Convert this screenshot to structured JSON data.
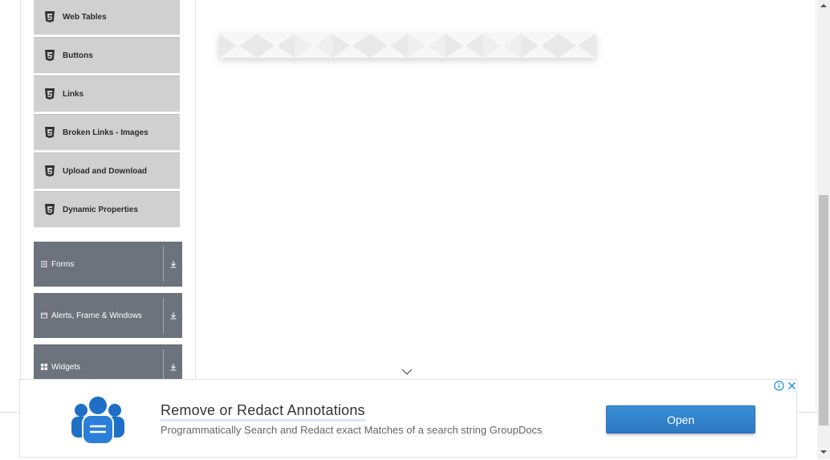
{
  "sidebar": {
    "elements_items": [
      {
        "label": "Web Tables"
      },
      {
        "label": "Buttons"
      },
      {
        "label": "Links"
      },
      {
        "label": "Broken Links - Images"
      },
      {
        "label": "Upload and Download"
      },
      {
        "label": "Dynamic Properties"
      }
    ],
    "groups": [
      {
        "label": "Forms",
        "icon": "form-icon"
      },
      {
        "label": "Alerts, Frame & Windows",
        "icon": "window-icon"
      },
      {
        "label": "Widgets",
        "icon": "grid-icon"
      }
    ]
  },
  "ad": {
    "title": "Remove or Redact Annotations",
    "description": "Programmatically Search and Redact exact Matches of a search string GroupDocs",
    "button_label": "Open",
    "button_color": "#2f80c9"
  },
  "colors": {
    "group_bg": "#6c737d",
    "item_bg": "#d0d0d0"
  }
}
